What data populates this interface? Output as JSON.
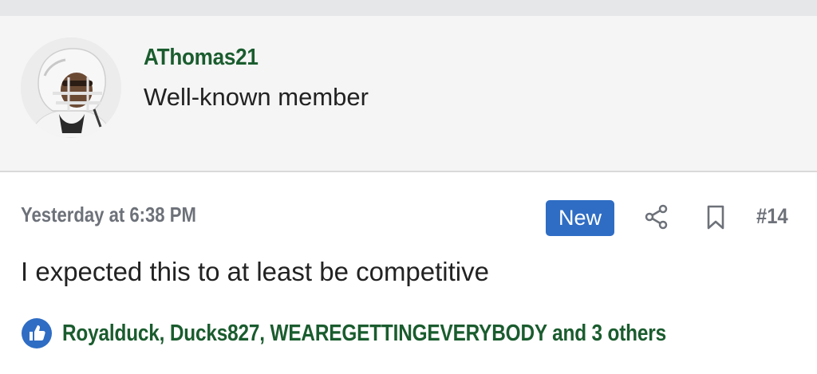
{
  "user": {
    "username": "AThomas21",
    "title": "Well-known member"
  },
  "post": {
    "timestamp": "Yesterday at 6:38 PM",
    "badge": "New",
    "number": "#14",
    "body": "I expected this to at least be competitive",
    "reactions": {
      "text": "Royalduck, Ducks827, WEAREGETTINGEVERYBODY and 3 others",
      "icon": "like-icon"
    }
  },
  "colors": {
    "username": "#1a5c2e",
    "reactions": "#1a5c2e",
    "badge_bg": "#2f6dc4",
    "meta_text": "#6d7179",
    "header_bg": "#f5f5f5",
    "like_icon": "#2f6dc4"
  },
  "icons": {
    "share": "share-icon",
    "bookmark": "bookmark-icon",
    "like": "thumbs-up-icon"
  }
}
